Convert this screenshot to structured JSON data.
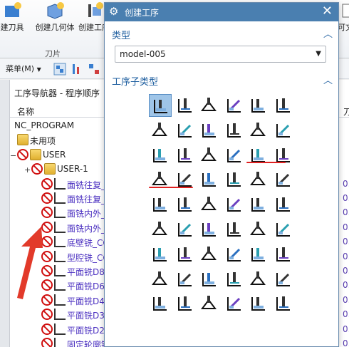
{
  "ribbon": {
    "buttons": [
      {
        "label": "建刀具",
        "icon": "create-tool-icon"
      },
      {
        "label": "创建几何体",
        "icon": "create-geometry-icon"
      },
      {
        "label": "创建工序",
        "icon": "create-operation-icon"
      }
    ],
    "right_fragment": "可文",
    "group_label": "刀片"
  },
  "toolbar": {
    "menu_label": "菜单(M)",
    "icons": [
      "program-order-view-icon",
      "machine-tool-view-icon",
      "geometry-view-icon"
    ]
  },
  "navigator": {
    "title": "工序导航器 - 程序顺序",
    "col_name": "名称",
    "col_time": "刀",
    "rows": [
      {
        "text": "NC_PROGRAM",
        "icon": "none",
        "indent": 0,
        "value": ""
      },
      {
        "text": "未用项",
        "icon": "folder",
        "indent": 1,
        "value": ""
      },
      {
        "text": "USER",
        "icon": "folder",
        "indent": 1,
        "value": ""
      },
      {
        "text": "USER-1",
        "icon": "folder",
        "indent": 2,
        "value": ""
      },
      {
        "text": "面铣往复_",
        "icon": "op",
        "indent": 3,
        "value": "0."
      },
      {
        "text": "面铣往复_",
        "icon": "op",
        "indent": 3,
        "value": "0."
      },
      {
        "text": "面铣内外_",
        "icon": "op",
        "indent": 3,
        "value": "0."
      },
      {
        "text": "面铣内外_",
        "icon": "op",
        "indent": 3,
        "value": "0."
      },
      {
        "text": "底壁铣_CO",
        "icon": "op",
        "indent": 3,
        "value": "0."
      },
      {
        "text": "型腔铣_CO",
        "icon": "op",
        "indent": 3,
        "value": "0."
      },
      {
        "text": "平面铣D8-",
        "icon": "op",
        "indent": 3,
        "value": "0."
      },
      {
        "text": "平面铣D6-",
        "icon": "op",
        "indent": 3,
        "value": "0."
      },
      {
        "text": "平面铣D4-",
        "icon": "op",
        "indent": 3,
        "value": "0."
      },
      {
        "text": "平面铣D3-",
        "icon": "op",
        "indent": 3,
        "value": "0."
      },
      {
        "text": "平面铣D2-",
        "icon": "op",
        "indent": 3,
        "value": "0."
      },
      {
        "text": "固定轮廓铣",
        "icon": "op",
        "indent": 3,
        "value": "0."
      }
    ]
  },
  "dialog": {
    "title": "创建工序",
    "type_section": "类型",
    "type_value": "model-005",
    "subtype_section": "工序子类型",
    "subtype_icons": [
      [
        "face-mill-icon",
        "face-mill-manual-icon",
        "planar-mill-icon",
        "planar-profile-icon",
        "cleanup-corners-icon",
        "finish-walls-icon"
      ],
      [
        "finish-floor-icon",
        "cavity-mill-icon",
        "corner-rough-icon",
        "zlevel-profile-icon",
        "zlevel-corner-icon",
        "fixed-contour-icon"
      ],
      [
        "floor-wall-icon",
        "floor-wall-ipw-icon",
        "face-mill-area-icon",
        "face-mill-boundary-icon",
        "planar-text-icon",
        "planar-mill-custom-icon"
      ],
      [
        "planar-profile-2-icon",
        "planar-rough-icon",
        "groove-mill-icon",
        "hole-mill-icon",
        "thread-mill-icon",
        "planar-finish-icon"
      ],
      [
        "contour-area-icon",
        "streamline-icon",
        "flowcut-icon",
        "area-mill-icon",
        "solid-profile-icon",
        "contour-text-icon"
      ],
      [
        "planar-profile-3-icon",
        "planar-profile-4-icon",
        "planar-profile-5-icon",
        "planar-profile-6-icon",
        "planar-profile-7-icon",
        "planar-profile-8-icon"
      ],
      [
        "planar-profile-9-icon",
        "planar-profile-10-icon",
        "planar-profile-11-icon",
        "planar-profile-12-icon",
        "planar-profile-13-icon",
        "engrave-icon"
      ],
      [
        "engrave-2-icon",
        "engrave-3-icon",
        "engrave-4-icon",
        "engrave-5-icon",
        "engrave-6-icon",
        "engrave-7-icon"
      ],
      [
        "engrave-8-icon",
        "engrave-9-icon",
        "engrave-10-icon",
        "engrave-11-icon",
        "engrave-12-icon",
        "engrave-13-icon"
      ]
    ],
    "selected_icon": "face-mill-icon"
  },
  "accent": "#4a7fb0",
  "annotation_color": "#e02020"
}
